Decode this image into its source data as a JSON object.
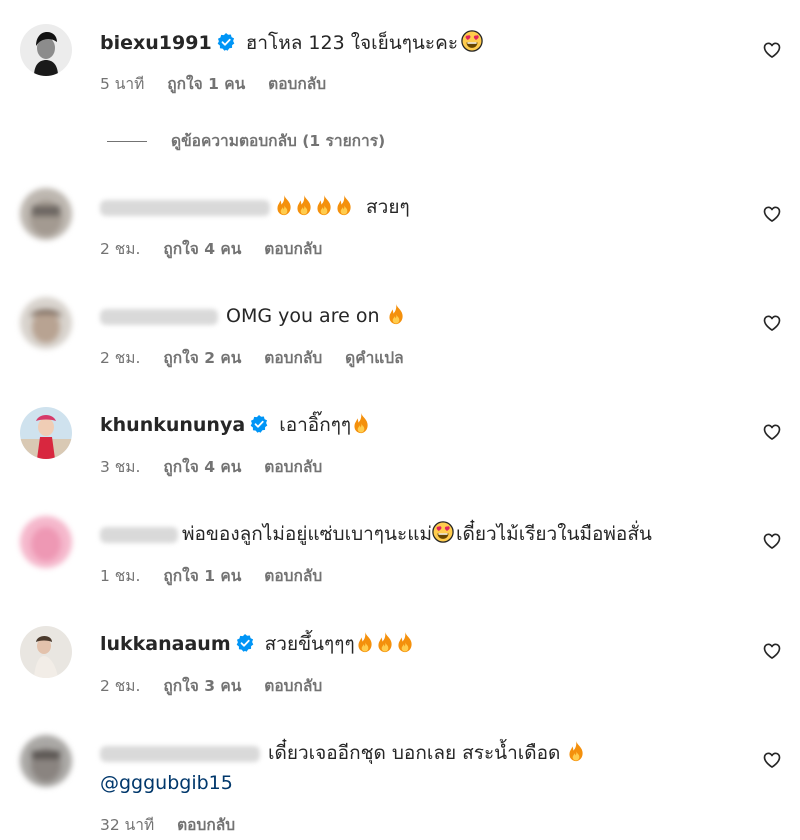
{
  "comments": [
    {
      "username": "biexu1991",
      "verified": true,
      "text": "ฮาโหล 123 ใจเย็นๆนะคะ",
      "time": "5 นาที",
      "likes": "ถูกใจ 1 คน",
      "reply": "ตอบกลับ"
    },
    {
      "username": "",
      "verified": false,
      "text": "สวยๆ",
      "time": "2 ชม.",
      "likes": "ถูกใจ 4 คน",
      "reply": "ตอบกลับ"
    },
    {
      "username": "",
      "verified": false,
      "text": "OMG you are on",
      "time": "2 ชม.",
      "likes": "ถูกใจ 2 คน",
      "reply": "ตอบกลับ",
      "translate": "ดูคำแปล"
    },
    {
      "username": "khunkununya",
      "verified": true,
      "text": "เอาอิ๊กๆๆ",
      "time": "3 ชม.",
      "likes": "ถูกใจ 4 คน",
      "reply": "ตอบกลับ"
    },
    {
      "username": "",
      "verified": false,
      "text_a": "พ่อของลูกไม่อยู่แซ่บเบาๆนะแม่",
      "text_b": "เดี๋ยวไม้เรียวในมือพ่อสั่น",
      "time": "1 ชม.",
      "likes": "ถูกใจ 1 คน",
      "reply": "ตอบกลับ"
    },
    {
      "username": "lukkanaaum",
      "verified": true,
      "text": "สวยขึ้นๆๆๆ",
      "time": "2 ชม.",
      "likes": "ถูกใจ 3 คน",
      "reply": "ตอบกลับ"
    },
    {
      "username": "",
      "verified": false,
      "text": "เดี๋ยวเจออีกชุด บอกเลย สระน้ำเดือด",
      "mention": "@gggubgib15",
      "time": "32 นาที",
      "reply": "ตอบกลับ"
    }
  ],
  "view_replies": "ดูข้อความตอบกลับ (1 รายการ)",
  "colors": {
    "text": "#262626",
    "meta": "#737373",
    "verified": "#0095f6",
    "mention": "#00376b"
  }
}
